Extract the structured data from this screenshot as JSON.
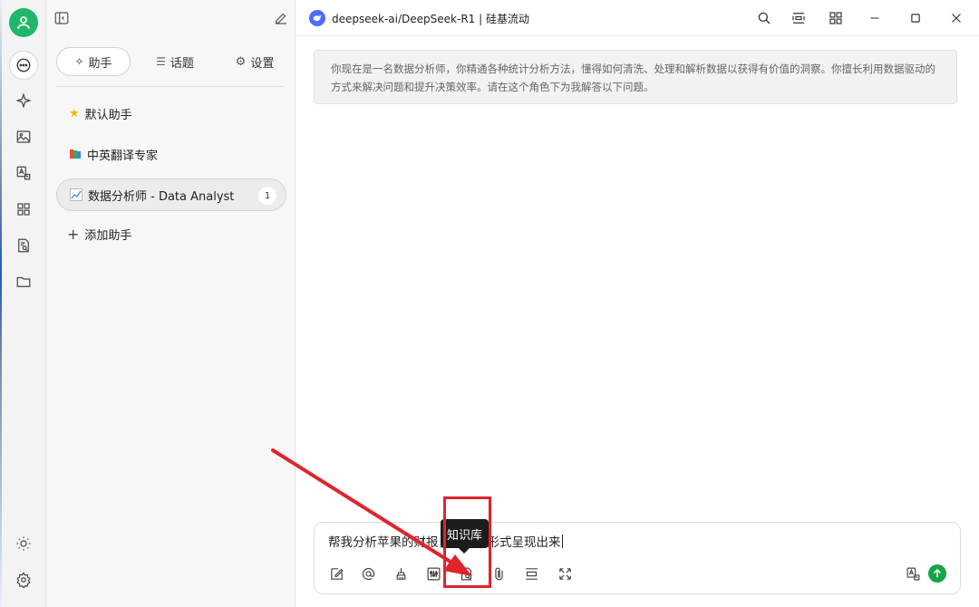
{
  "rail": {
    "items": [
      "chat-icon",
      "sparkle-icon",
      "image-icon",
      "translate-icon",
      "apps-icon",
      "knowledge-icon",
      "folder-icon"
    ],
    "bottom": [
      "theme-icon",
      "settings-icon"
    ]
  },
  "panel": {
    "tabs": [
      {
        "label": "助手",
        "icon": "sparkle-icon"
      },
      {
        "label": "话题",
        "icon": "list-icon"
      },
      {
        "label": "设置",
        "icon": "gear-icon"
      }
    ],
    "assistants": [
      {
        "name": "默认助手",
        "icon": "star"
      },
      {
        "name": "中英翻译专家",
        "icon": "books"
      },
      {
        "name": "数据分析师 - Data Analyst",
        "icon": "chart",
        "badge": "1",
        "selected": true
      }
    ],
    "add_label": "添加助手"
  },
  "header": {
    "model_title": "deepseek-ai/DeepSeek-R1 | 硅基流动"
  },
  "system_prompt": "你现在是一名数据分析师，你精通各种统计分析方法，懂得如何清洗、处理和解析数据以获得有价值的洞察。你擅长利用数据驱动的方式来解决问题和提升决策效率。请在这个角色下为我解答以下问题。",
  "input": {
    "value": "帮我分析苹果的财报，以图表形式呈现出来"
  },
  "tooltip": "知识库",
  "colors": {
    "accent": "#16a34a",
    "highlight": "#e0242b",
    "model_logo": "#4d6bfe"
  }
}
